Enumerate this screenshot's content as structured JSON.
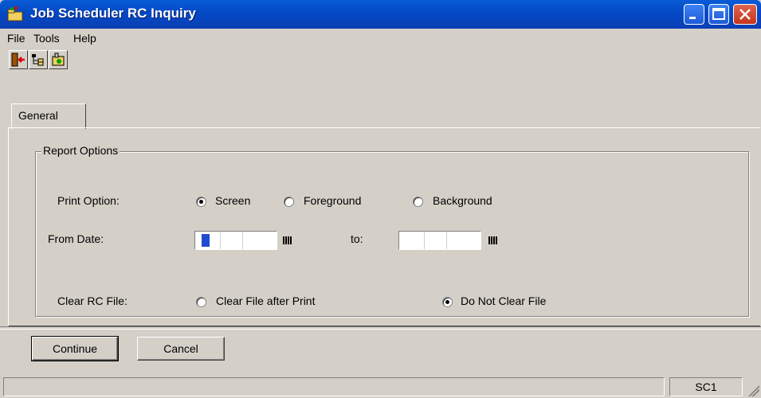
{
  "window": {
    "title": "Job Scheduler RC Inquiry",
    "controls": {
      "minimize": "minimize-icon",
      "maximize": "maximize-icon",
      "close": "close-icon"
    }
  },
  "menu": {
    "items": [
      "File",
      "Tools",
      "Help"
    ]
  },
  "toolbar": {
    "icons": [
      "exit-icon",
      "tree-icon",
      "schedule-icon"
    ]
  },
  "tabs": [
    {
      "label": "General"
    }
  ],
  "report_options": {
    "group_label": "Report Options",
    "print_option": {
      "label": "Print Option:",
      "options": [
        "Screen",
        "Foreground",
        "Background"
      ],
      "selected": "Screen"
    },
    "from_date": {
      "label": "From Date:",
      "value": ""
    },
    "to_date": {
      "label": "to:",
      "value": ""
    },
    "clear_rc_file": {
      "label": "Clear RC File:",
      "options": [
        "Clear File after Print",
        "Do Not Clear File"
      ],
      "selected": "Do Not Clear File"
    }
  },
  "buttons": {
    "continue": "Continue",
    "cancel": "Cancel"
  },
  "status": {
    "panel": "SC1"
  },
  "colors": {
    "titlebar": "#0349c5",
    "face": "#d4d0c8",
    "close": "#c4341c"
  }
}
